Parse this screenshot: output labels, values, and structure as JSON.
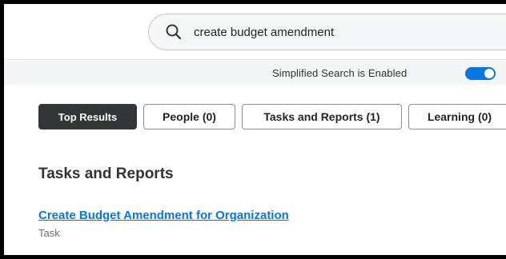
{
  "search": {
    "query": "create budget amendment",
    "icon": "search-icon"
  },
  "banner": {
    "text": "Simplified Search is Enabled",
    "toggle_on": true,
    "toggle_color": "#0875e1"
  },
  "tabs": [
    {
      "label": "Top Results",
      "active": true
    },
    {
      "label": "People (0)",
      "active": false
    },
    {
      "label": "Tasks and Reports (1)",
      "active": false
    },
    {
      "label": "Learning (0)",
      "active": false
    }
  ],
  "section": {
    "title": "Tasks and Reports"
  },
  "results": [
    {
      "title": "Create Budget Amendment for Organization",
      "type": "Task"
    }
  ],
  "colors": {
    "link": "#0875e1",
    "active_tab": "#333639"
  }
}
